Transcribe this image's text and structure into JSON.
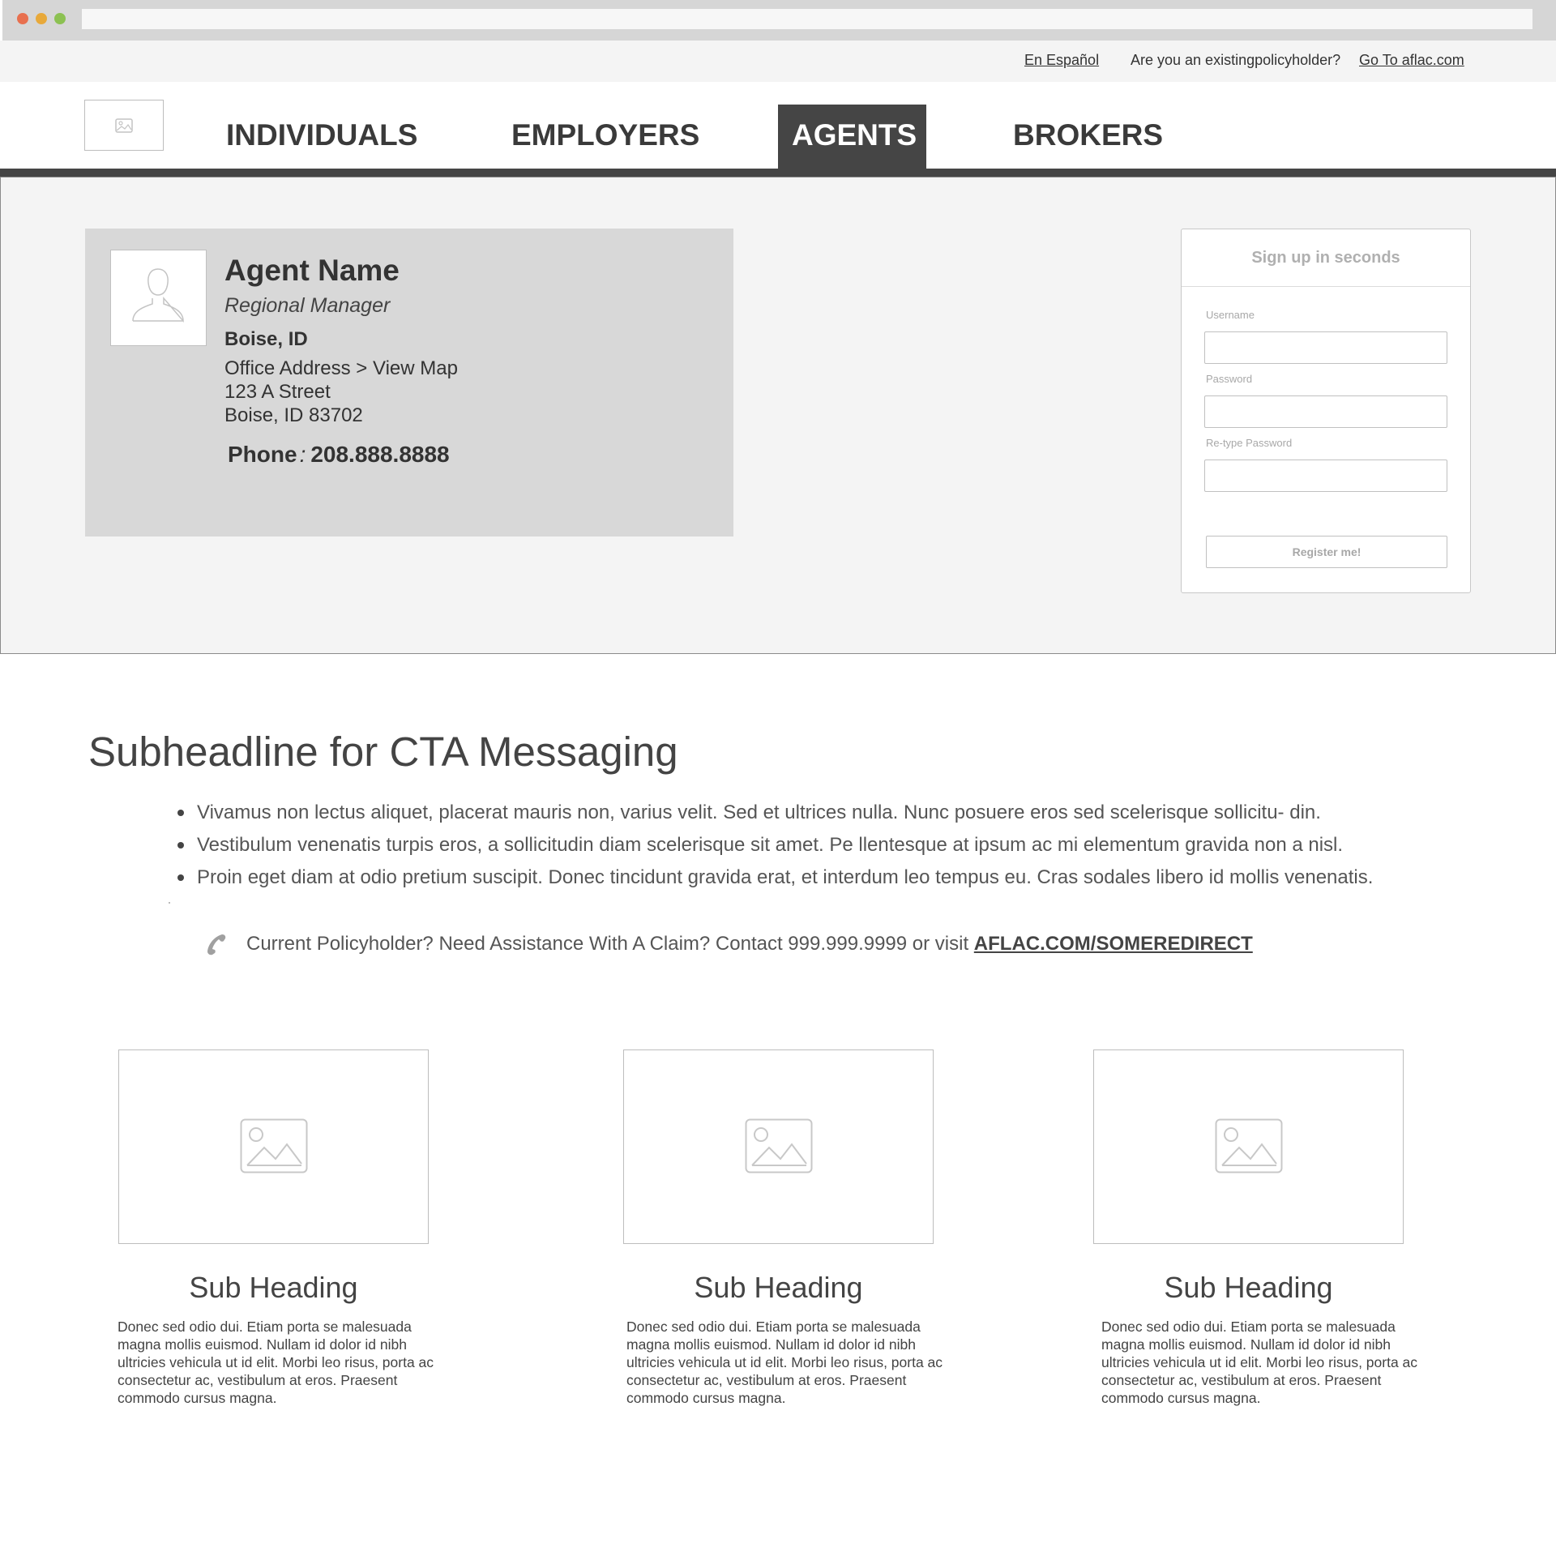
{
  "browser": {
    "dots": [
      "#e8704f",
      "#e8a93a",
      "#8cc152"
    ]
  },
  "topbar": {
    "spanish_link": "En Español",
    "question": "Are you an existingpolicyholder?",
    "aflac_link": "Go To aflac.com"
  },
  "nav": {
    "logo_icon": "image-icon",
    "tabs": [
      "INDIVIDUALS",
      "EMPLOYERS",
      "AGENTS",
      "BROKERS"
    ],
    "active_tab": "AGENTS",
    "bar_color": "#454545"
  },
  "agent": {
    "avatar_icon": "user-silhouette-icon",
    "name": "Agent Name",
    "title": "Regional Manager",
    "location": "Boise, ID",
    "office_label": "Office Address > View Map",
    "street": "123 A Street",
    "city": "Boise, ID 83702",
    "phone_label": "Phone",
    "phone_sep": ":",
    "phone": "208.888.8888"
  },
  "signup": {
    "title": "Sign up in seconds",
    "username_label": "Username",
    "password_label": "Password",
    "retype_label": "Re-type Password",
    "button": "Register me!"
  },
  "cta": {
    "headline": "Subheadline for CTA Messaging",
    "bullets": [
      "Vivamus non lectus aliquet, placerat mauris non, varius velit. Sed et ultrices nulla. Nunc posuere eros sed scelerisque sollicitu- din.",
      "Vestibulum venenatis turpis eros, a sollicitudin diam scelerisque sit amet. Pe llentesque at ipsum ac mi elementum gravida non a nisl.",
      "Proin eget diam at odio pretium suscipit. Donec tincidunt gravida erat, et interdum leo tempus eu. Cras sodales libero id mollis venenatis."
    ],
    "contact_icon": "phone-icon",
    "contact_text": "Current Policyholder? Need Assistance With A Claim? Contact 999.999.9999 or visit ",
    "contact_link": "AFLAC.COM/SOMEREDIRECT"
  },
  "columns": [
    {
      "image_icon": "image-placeholder-icon",
      "heading": "Sub Heading",
      "body": "Donec sed odio dui. Etiam porta se malesuada magna mollis euismod. Nullam id dolor id nibh ultricies vehicula ut id elit. Morbi leo risus, porta ac consectetur ac, vestibulum at eros. Praesent commodo cursus magna."
    },
    {
      "image_icon": "image-placeholder-icon",
      "heading": "Sub Heading",
      "body": "Donec sed odio dui. Etiam porta se malesuada magna mollis euismod. Nullam id dolor id nibh ultricies vehicula ut id elit. Morbi leo risus, porta ac consectetur ac, vestibulum at eros. Praesent commodo cursus magna."
    },
    {
      "image_icon": "image-placeholder-icon",
      "heading": "Sub Heading",
      "body": "Donec sed odio dui. Etiam porta se malesuada magna mollis euismod. Nullam id dolor id nibh ultricies vehicula ut id elit. Morbi leo risus, porta ac consectetur ac, vestibulum at eros. Praesent commodo cursus magna."
    }
  ]
}
